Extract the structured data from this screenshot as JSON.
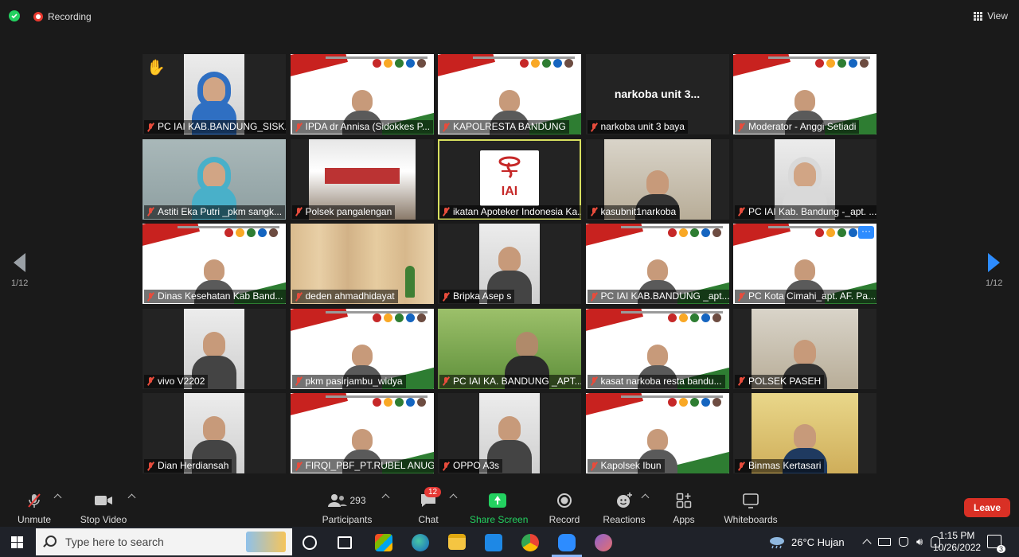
{
  "topbar": {
    "recording_label": "Recording",
    "view_label": "View"
  },
  "pager": {
    "left": "1/12",
    "right": "1/12"
  },
  "participants_grid": [
    {
      "name": "PC IAI KAB.BANDUNG_SISK...",
      "video": "person",
      "hand_raised": true
    },
    {
      "name": "IPDA dr Annisa (Sidokkes P...",
      "video": "slide"
    },
    {
      "name": "KAPOLRESTA BANDUNG",
      "video": "slide"
    },
    {
      "name": "narkoba unit 3 baya",
      "video": "name_only",
      "display_name": "narkoba unit 3..."
    },
    {
      "name": "Moderator - Anggi Setiadi",
      "video": "slide"
    },
    {
      "name": "Astiti Eka Putri _pkm sangk...",
      "video": "person"
    },
    {
      "name": "Polsek pangalengan",
      "video": "tent"
    },
    {
      "name": "ikatan Apoteker Indonesia Ka...",
      "video": "logo",
      "logo_text": "IAI",
      "active_speaker": true
    },
    {
      "name": "kasubnit1narkoba",
      "video": "room"
    },
    {
      "name": "PC IAI Kab. Bandung -_apt. ...",
      "video": "person"
    },
    {
      "name": "Dinas Kesehatan Kab Band...",
      "video": "slide"
    },
    {
      "name": "deden ahmadhidayat",
      "video": "wood"
    },
    {
      "name": "Bripka Asep s",
      "video": "person"
    },
    {
      "name": "PC IAI KAB.BANDUNG _apt....",
      "video": "slide"
    },
    {
      "name": "PC Kota Cimahi_apt. AF. Pa...",
      "video": "slide",
      "more_button": "···"
    },
    {
      "name": "vivo V2202",
      "video": "person"
    },
    {
      "name": "pkm pasirjambu_widya",
      "video": "slide"
    },
    {
      "name": "PC IAI KA. BANDUNG _APT....",
      "video": "green"
    },
    {
      "name": "kasat narkoba resta bandu...",
      "video": "slide"
    },
    {
      "name": "POLSEK PASEH",
      "video": "room"
    },
    {
      "name": "Dian Herdiansah",
      "video": "person"
    },
    {
      "name": "FIRQI_PBF_PT.RUBEL ANUG...",
      "video": "slide"
    },
    {
      "name": "OPPO A3s",
      "video": "person"
    },
    {
      "name": "Kapolsek Ibun",
      "video": "slide"
    },
    {
      "name": "Binmas Kertasari",
      "video": "yellow"
    }
  ],
  "controls": {
    "unmute": "Unmute",
    "stop_video": "Stop Video",
    "participants": "Participants",
    "participants_count": "293",
    "chat": "Chat",
    "chat_badge": "12",
    "share_screen": "Share Screen",
    "record": "Record",
    "reactions": "Reactions",
    "apps": "Apps",
    "whiteboards": "Whiteboards",
    "leave": "Leave"
  },
  "colors": {
    "share_green": "#23d160",
    "leave_red": "#d93025",
    "active_outline": "#d8e060",
    "accent_blue": "#2d8cff"
  },
  "taskbar": {
    "search_placeholder": "Type here to search",
    "weather": "26°C  Hujan",
    "time": "1:15 PM",
    "date": "10/26/2022",
    "notifications": "3"
  }
}
